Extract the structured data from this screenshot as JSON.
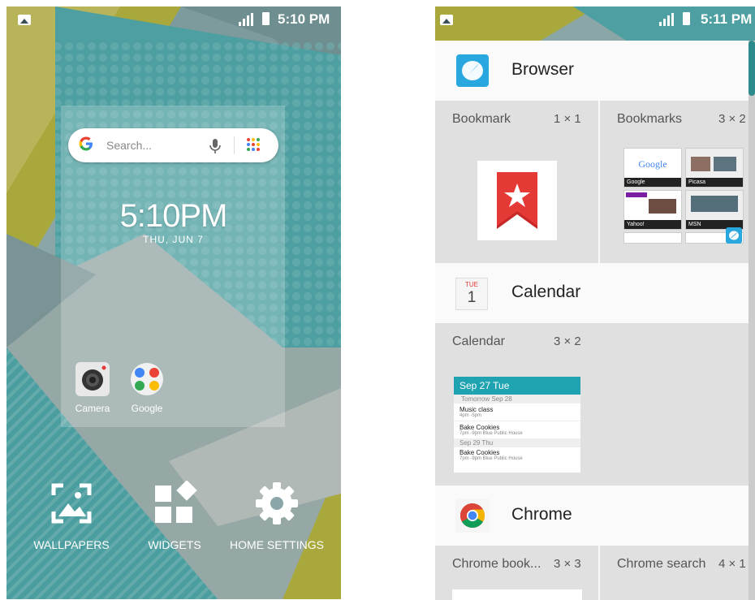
{
  "left_screen": {
    "status_bar": {
      "time": "5:10 PM"
    },
    "search": {
      "placeholder": "Search..."
    },
    "clock": {
      "time": "5:10PM",
      "date": "THU, JUN 7"
    },
    "apps": [
      {
        "label": "Camera",
        "icon": "camera-icon"
      },
      {
        "label": "Google",
        "icon": "google-folder-icon"
      }
    ],
    "actions": [
      {
        "label": "WALLPAPERS",
        "icon": "wallpaper-icon"
      },
      {
        "label": "WIDGETS",
        "icon": "widgets-icon"
      },
      {
        "label": "HOME SETTINGS",
        "icon": "gear-icon"
      }
    ]
  },
  "right_screen": {
    "status_bar": {
      "time": "5:11 PM"
    },
    "apps": [
      {
        "name": "Browser",
        "icon": "browser-icon",
        "widgets": [
          {
            "label": "Bookmark",
            "size": "1 × 1"
          },
          {
            "label": "Bookmarks",
            "size": "3 × 2"
          }
        ]
      },
      {
        "name": "Calendar",
        "icon": "calendar-icon",
        "icon_day": "TUE",
        "icon_date": "1",
        "widgets": [
          {
            "label": "Calendar",
            "size": "3 × 2"
          }
        ]
      },
      {
        "name": "Chrome",
        "icon": "chrome-icon",
        "widgets": [
          {
            "label": "Chrome book...",
            "size": "3 × 3"
          },
          {
            "label": "Chrome search",
            "size": "4 × 1"
          }
        ]
      }
    ],
    "bookmark_thumbs": [
      "Google",
      "Picasa",
      "Yahoo!",
      "MSN"
    ],
    "calendar_preview": {
      "header": "Sep 27  Tue",
      "sub1": "Tomorrow   Sep 28",
      "event1_title": "Music class",
      "event1_time": "4pm -5pm",
      "event2_title": "Bake Cookies",
      "event2_time": "7pm -9pm   Blue  Public House",
      "sub2": "Sep 29  Thu",
      "event3_title": "Bake Cookies",
      "event3_time": "7pm -9pm   Blue  Public House"
    }
  },
  "colors": {
    "teal": "#2e8b8b",
    "lime": "#a9a83c",
    "accent_blue": "#29a8e0",
    "bookmark_red": "#d32f2f",
    "calendar_teal": "#1fa3b0"
  }
}
